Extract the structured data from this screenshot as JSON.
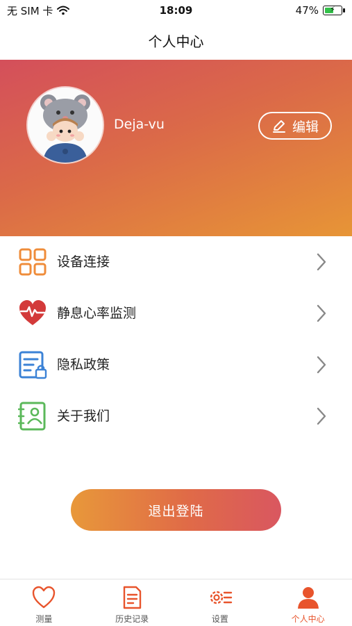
{
  "status_bar": {
    "carrier": "无 SIM 卡",
    "time": "18:09",
    "battery": "47%",
    "icons": [
      "wifi-icon",
      "battery-charging-icon"
    ]
  },
  "nav": {
    "title": "个人中心"
  },
  "profile": {
    "username": "Deja-vu",
    "edit_label": "编辑",
    "colors": {
      "gradient_start": "#d44f5b",
      "gradient_end": "#e79536"
    }
  },
  "menu": {
    "items": [
      {
        "label": "设备连接",
        "icon": "grid-icon",
        "color": "#ef8c3a"
      },
      {
        "label": "静息心率监测",
        "icon": "heart-pulse-icon",
        "color": "#d33a3a"
      },
      {
        "label": "隐私政策",
        "icon": "document-lock-icon",
        "color": "#3b82d6"
      },
      {
        "label": "关于我们",
        "icon": "contact-card-icon",
        "color": "#5bb85a"
      }
    ]
  },
  "logout": {
    "label": "退出登陆"
  },
  "tab_bar": {
    "accent": "#e8542c",
    "items": [
      {
        "label": "测量",
        "icon": "heart-outline-icon"
      },
      {
        "label": "历史记录",
        "icon": "history-document-icon"
      },
      {
        "label": "设置",
        "icon": "settings-gear-icon"
      },
      {
        "label": "个人中心",
        "icon": "user-icon",
        "active": true
      }
    ]
  }
}
